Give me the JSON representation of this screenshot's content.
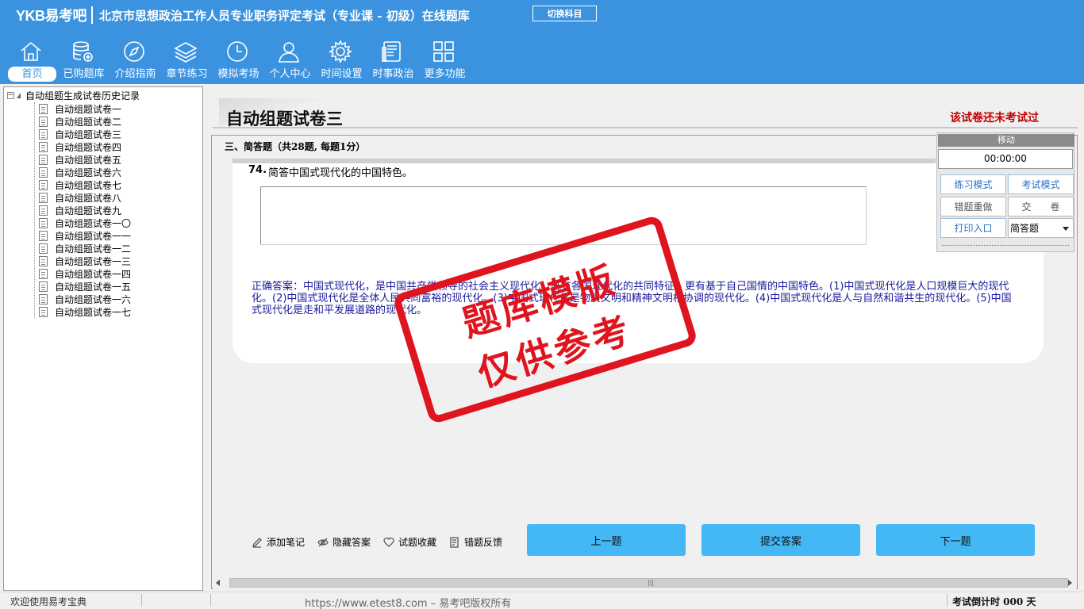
{
  "header": {
    "logo": "YKB易考吧",
    "title": "北京市思想政治工作人员专业职务评定考试（专业课 - 初级）在线题库",
    "switch_label": "切换科目"
  },
  "nav": [
    {
      "label": "首页",
      "icon": "home-icon"
    },
    {
      "label": "已购题库",
      "icon": "database-icon"
    },
    {
      "label": "介绍指南",
      "icon": "compass-icon"
    },
    {
      "label": "章节练习",
      "icon": "layers-icon"
    },
    {
      "label": "模拟考场",
      "icon": "clock-icon"
    },
    {
      "label": "个人中心",
      "icon": "user-icon"
    },
    {
      "label": "时间设置",
      "icon": "gear-icon"
    },
    {
      "label": "时事政治",
      "icon": "newspaper-icon"
    },
    {
      "label": "更多功能",
      "icon": "grid-icon"
    }
  ],
  "tree": {
    "root": "自动组题生成试卷历史记录",
    "items": [
      "自动组题试卷一",
      "自动组题试卷二",
      "自动组题试卷三",
      "自动组题试卷四",
      "自动组题试卷五",
      "自动组题试卷六",
      "自动组题试卷七",
      "自动组题试卷八",
      "自动组题试卷九",
      "自动组题试卷一〇",
      "自动组题试卷一一",
      "自动组题试卷一二",
      "自动组题试卷一三",
      "自动组题试卷一四",
      "自动组题试卷一五",
      "自动组题试卷一六",
      "自动组题试卷一七"
    ]
  },
  "paper": {
    "title": "自动组题试卷三",
    "status": "该试卷还未考试过",
    "section": "三、简答题（共28题, 每题1分）",
    "question_number": "74.",
    "question_text": "简答中国式现代化的中国特色。",
    "correct_answer": "正确答案：中国式现代化，是中国共产党领导的社会主义现代化，既有各国现代化的共同特征，更有基于自己国情的中国特色。(1)中国式现代化是人口规模巨大的现代化。(2)中国式现代化是全体人民共同富裕的现代化。(3)中国式现代化是物质文明和精神文明相协调的现代化。(4)中国式现代化是人与自然和谐共生的现代化。(5)中国式现代化是走和平发展道路的现代化。"
  },
  "stamp": {
    "line1": "题库模版",
    "line2": "仅供参考",
    "color": "#e0141e"
  },
  "tools": [
    {
      "label": "添加笔记",
      "icon": "pencil-icon"
    },
    {
      "label": "隐藏答案",
      "icon": "eye-off-icon"
    },
    {
      "label": "试题收藏",
      "icon": "heart-icon"
    },
    {
      "label": "错题反馈",
      "icon": "feedback-icon"
    }
  ],
  "buttons": {
    "prev": "上一题",
    "submit": "提交答案",
    "next": "下一题"
  },
  "panel": {
    "header": "移动",
    "timer": "00:00:00",
    "practice_mode": "练习模式",
    "exam_mode": "考试模式",
    "redo_wrong": "错题重做",
    "hand_in": "交　　卷",
    "print": "打印入口",
    "type_select": "简答题"
  },
  "statusbar": {
    "welcome": "欢迎使用易考宝典",
    "copyright": "https://www.etest8.com – 易考吧版权所有",
    "countdown": "考试倒计时 000 天"
  },
  "colors": {
    "header_bg": "#3b93e0",
    "button_bg": "#44b8f5",
    "status_red": "#c00000",
    "answer_blue": "#1a1a9c"
  }
}
